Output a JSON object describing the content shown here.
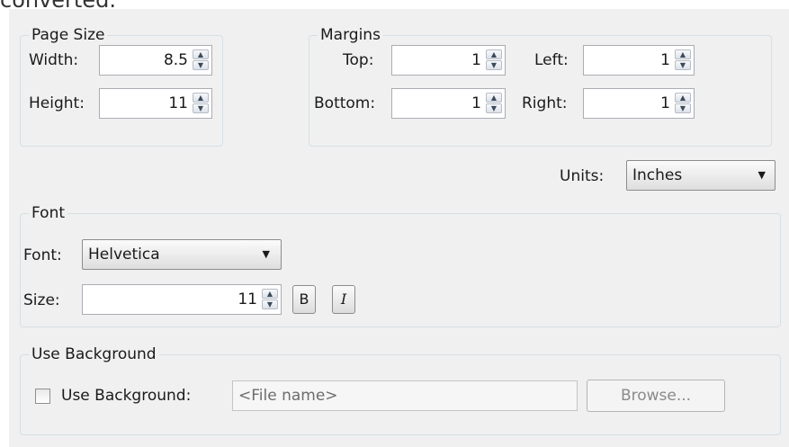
{
  "caption": "converted.",
  "page_size": {
    "legend": "Page Size",
    "width_label": "Width:",
    "width_value": "8.5",
    "height_label": "Height:",
    "height_value": "11"
  },
  "margins": {
    "legend": "Margins",
    "top_label": "Top:",
    "top_value": "1",
    "bottom_label": "Bottom:",
    "bottom_value": "1",
    "left_label": "Left:",
    "left_value": "1",
    "right_label": "Right:",
    "right_value": "1"
  },
  "units": {
    "label": "Units:",
    "selected": "Inches"
  },
  "font": {
    "legend": "Font",
    "font_label": "Font:",
    "font_selected": "Helvetica",
    "size_label": "Size:",
    "size_value": "11",
    "bold_label": "B",
    "italic_label": "I"
  },
  "background": {
    "legend": "Use Background",
    "checkbox_label": "Use Background:",
    "checked": false,
    "file_placeholder": "<File name>",
    "browse_label": "Browse..."
  },
  "icons": {
    "spin_up": "spin-up-arrow-icon",
    "spin_down": "spin-down-arrow-icon",
    "dropdown": "chevron-down-icon"
  },
  "colors": {
    "panel_background": "#f0f0f0",
    "group_border": "#d5dfe5",
    "input_border": "#abadb3"
  }
}
